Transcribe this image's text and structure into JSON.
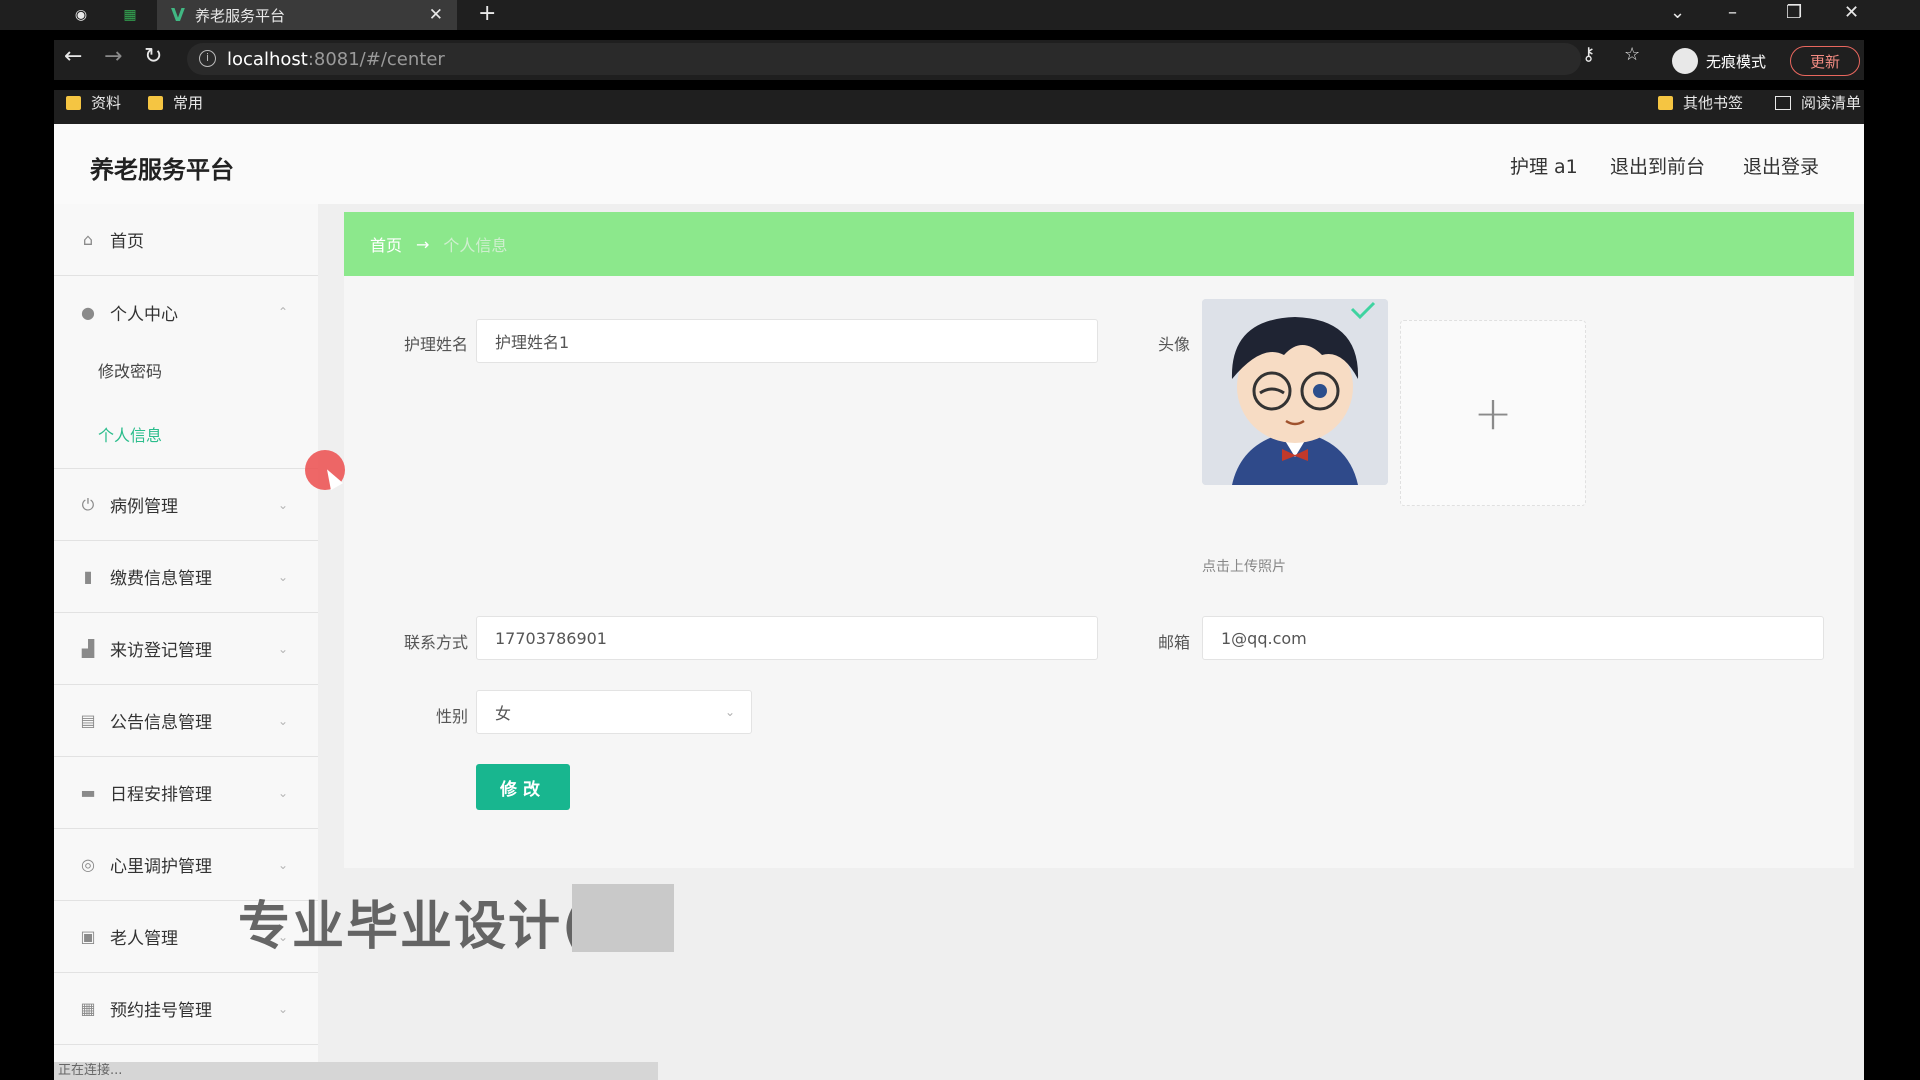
{
  "browser": {
    "tab_title": "养老服务平台",
    "url_host": "localhost",
    "url_path": ":8081/#/center",
    "incognito_label": "无痕模式",
    "update_label": "更新",
    "bookmarks": [
      "资料",
      "常用"
    ],
    "other_bookmarks": "其他书签",
    "reading_list": "阅读清单"
  },
  "header": {
    "brand": "养老服务平台",
    "user": "护理 a1",
    "to_front": "退出到前台",
    "logout": "退出登录"
  },
  "sidebar": {
    "home": "首页",
    "personal_center": "个人中心",
    "change_password": "修改密码",
    "personal_info": "个人信息",
    "items": [
      "病例管理",
      "缴费信息管理",
      "来访登记管理",
      "公告信息管理",
      "日程安排管理",
      "心里调护管理",
      "老人管理",
      "预约挂号管理"
    ]
  },
  "breadcrumb": {
    "home": "首页",
    "arrow": "→",
    "current": "个人信息"
  },
  "form": {
    "name_label": "护理姓名",
    "name_value": "护理姓名1",
    "avatar_label": "头像",
    "upload_plus": "+",
    "upload_tip": "点击上传照片",
    "phone_label": "联系方式",
    "phone_value": "17703786901",
    "email_label": "邮箱",
    "email_value": "1@qq.com",
    "gender_label": "性别",
    "gender_value": "女",
    "submit": "修改"
  },
  "overlay": {
    "watermark": "专业毕业设计("
  },
  "status": {
    "text": "正在连接..."
  }
}
